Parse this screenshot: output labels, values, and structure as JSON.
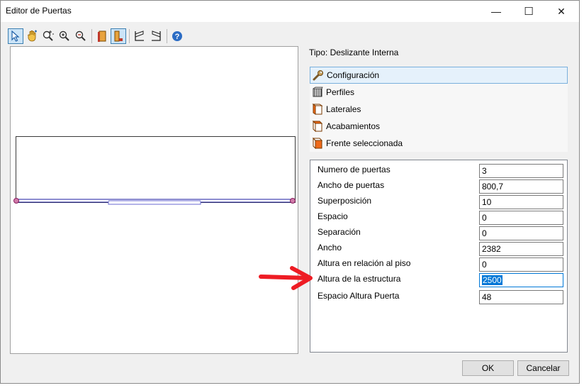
{
  "window": {
    "title": "Editor de Puertas",
    "minimize_glyph": "—",
    "maximize_glyph": "☐",
    "close_glyph": "✕"
  },
  "toolbar": {
    "icons": [
      "select-arrow-icon",
      "pan-hand-icon",
      "zoom-extents-icon",
      "zoom-in-icon",
      "zoom-out-icon",
      "front-view-icon",
      "side-view-icon",
      "left-profile-icon",
      "right-profile-icon",
      "help-icon"
    ],
    "active": "side-view-icon"
  },
  "tipo": "Tipo: Deslizante Interna",
  "sections": [
    {
      "label": "Configuración",
      "icon": "wrench-icon",
      "selected": true
    },
    {
      "label": "Perfiles",
      "icon": "profiles-icon",
      "selected": false
    },
    {
      "label": "Laterales",
      "icon": "laterals-box-icon",
      "selected": false
    },
    {
      "label": "Acabamientos",
      "icon": "finishes-box-icon",
      "selected": false
    },
    {
      "label": "Frente seleccionada",
      "icon": "front-box-icon",
      "selected": false
    }
  ],
  "properties": [
    {
      "label": "Numero de puertas",
      "value": "3"
    },
    {
      "label": "Ancho de puertas",
      "value": "800,7"
    },
    {
      "label": "Superposición",
      "value": "10"
    },
    {
      "label": "Espacio",
      "value": "0"
    },
    {
      "label": "Separación",
      "value": "0"
    },
    {
      "label": "Ancho",
      "value": "2382"
    },
    {
      "label": "Altura en relación al piso",
      "value": "0"
    },
    {
      "label": "Altura de la estructura",
      "value": "2500",
      "selected": true
    },
    {
      "label": "Espacio Altura Puerta",
      "value": "48"
    }
  ],
  "buttons": {
    "ok": "OK",
    "cancel": "Cancelar"
  },
  "colors": {
    "accent": "#0078d7",
    "annotation_arrow": "#ee1c24",
    "drawing_line": "#1e1ea0"
  }
}
